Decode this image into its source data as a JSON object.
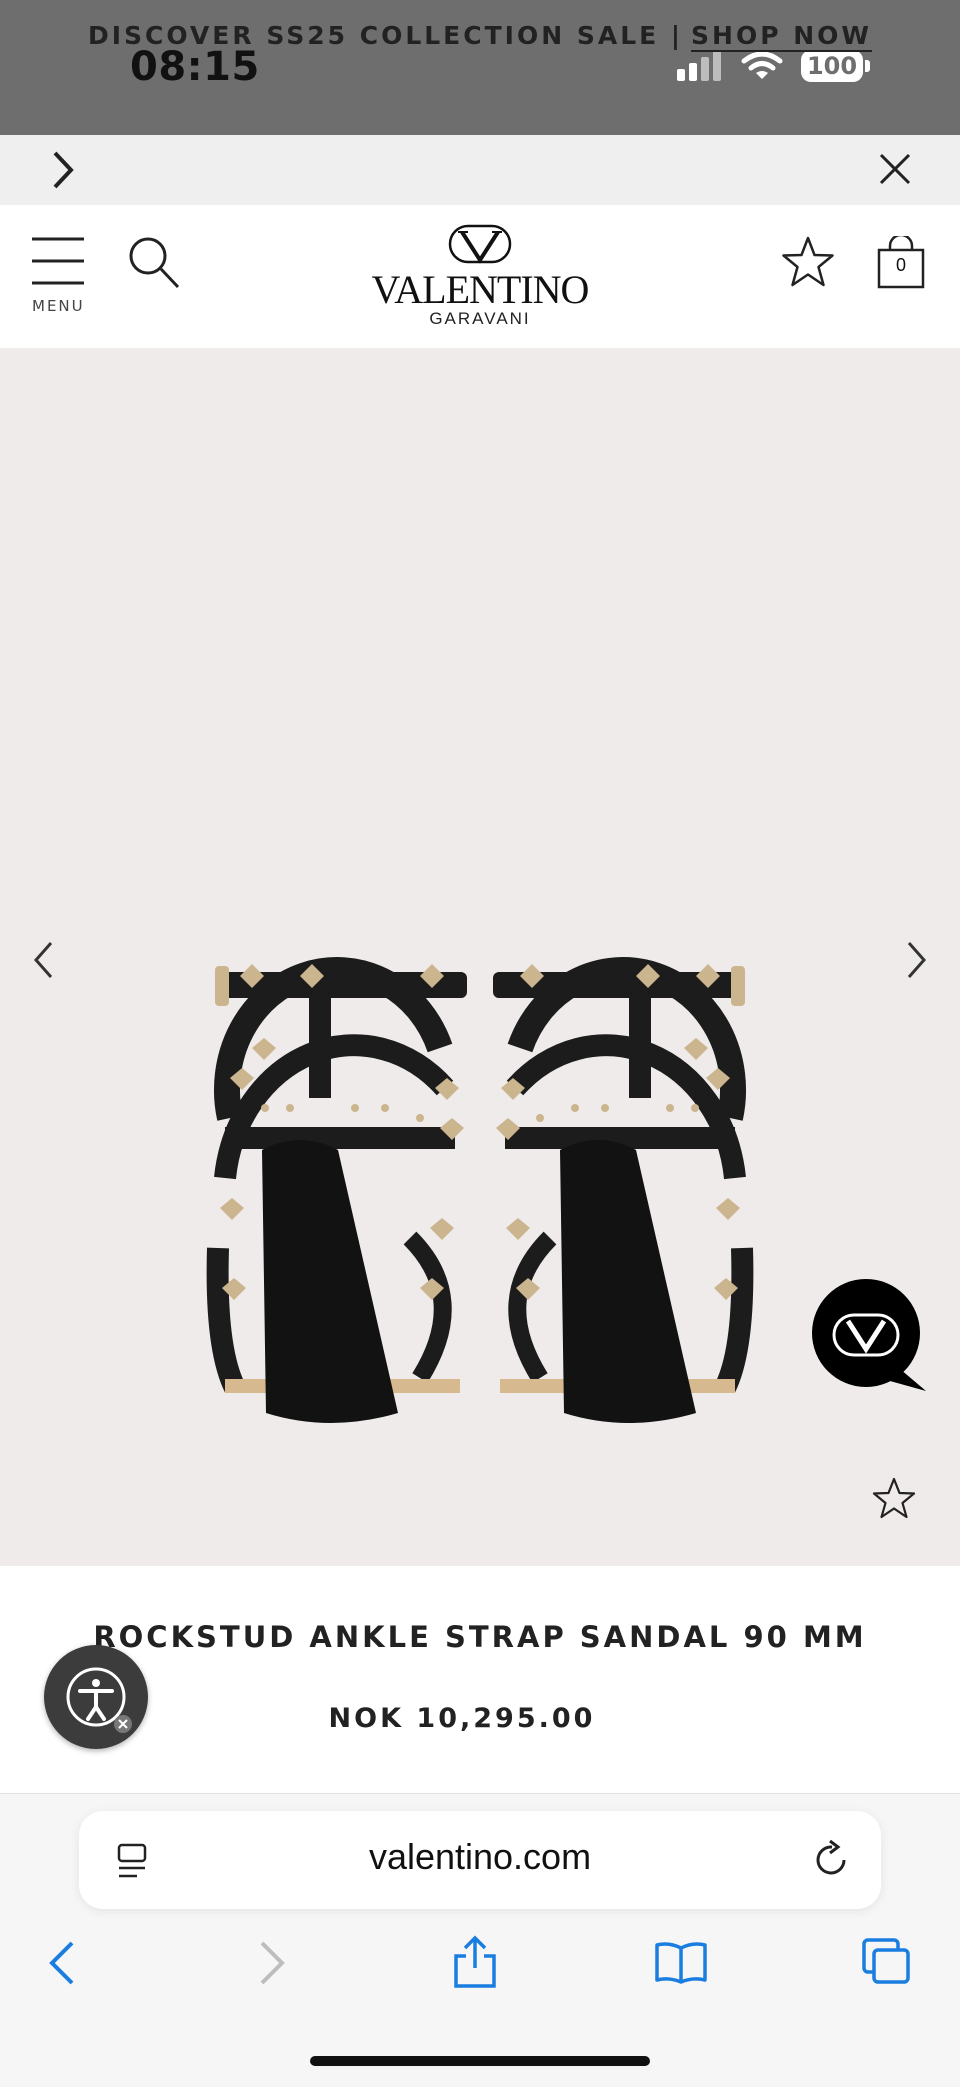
{
  "status_bar": {
    "time": "08:15",
    "battery": "100"
  },
  "promo": {
    "text": "DISCOVER SS25 COLLECTION SALE |",
    "link": "SHOP NOW"
  },
  "header": {
    "menu_label": "MENU",
    "logo_word": "VALENTINO",
    "logo_sub": "GARAVANI",
    "cart_count": "0"
  },
  "product": {
    "title": "ROCKSTUD ANKLE STRAP SANDAL 90 MM",
    "price": "NOK 10,295.00"
  },
  "browser": {
    "url": "valentino.com"
  },
  "colors": {
    "accent_blue": "#1a7de0",
    "status_bg": "#6e6e6e",
    "image_bg": "#efebea"
  }
}
